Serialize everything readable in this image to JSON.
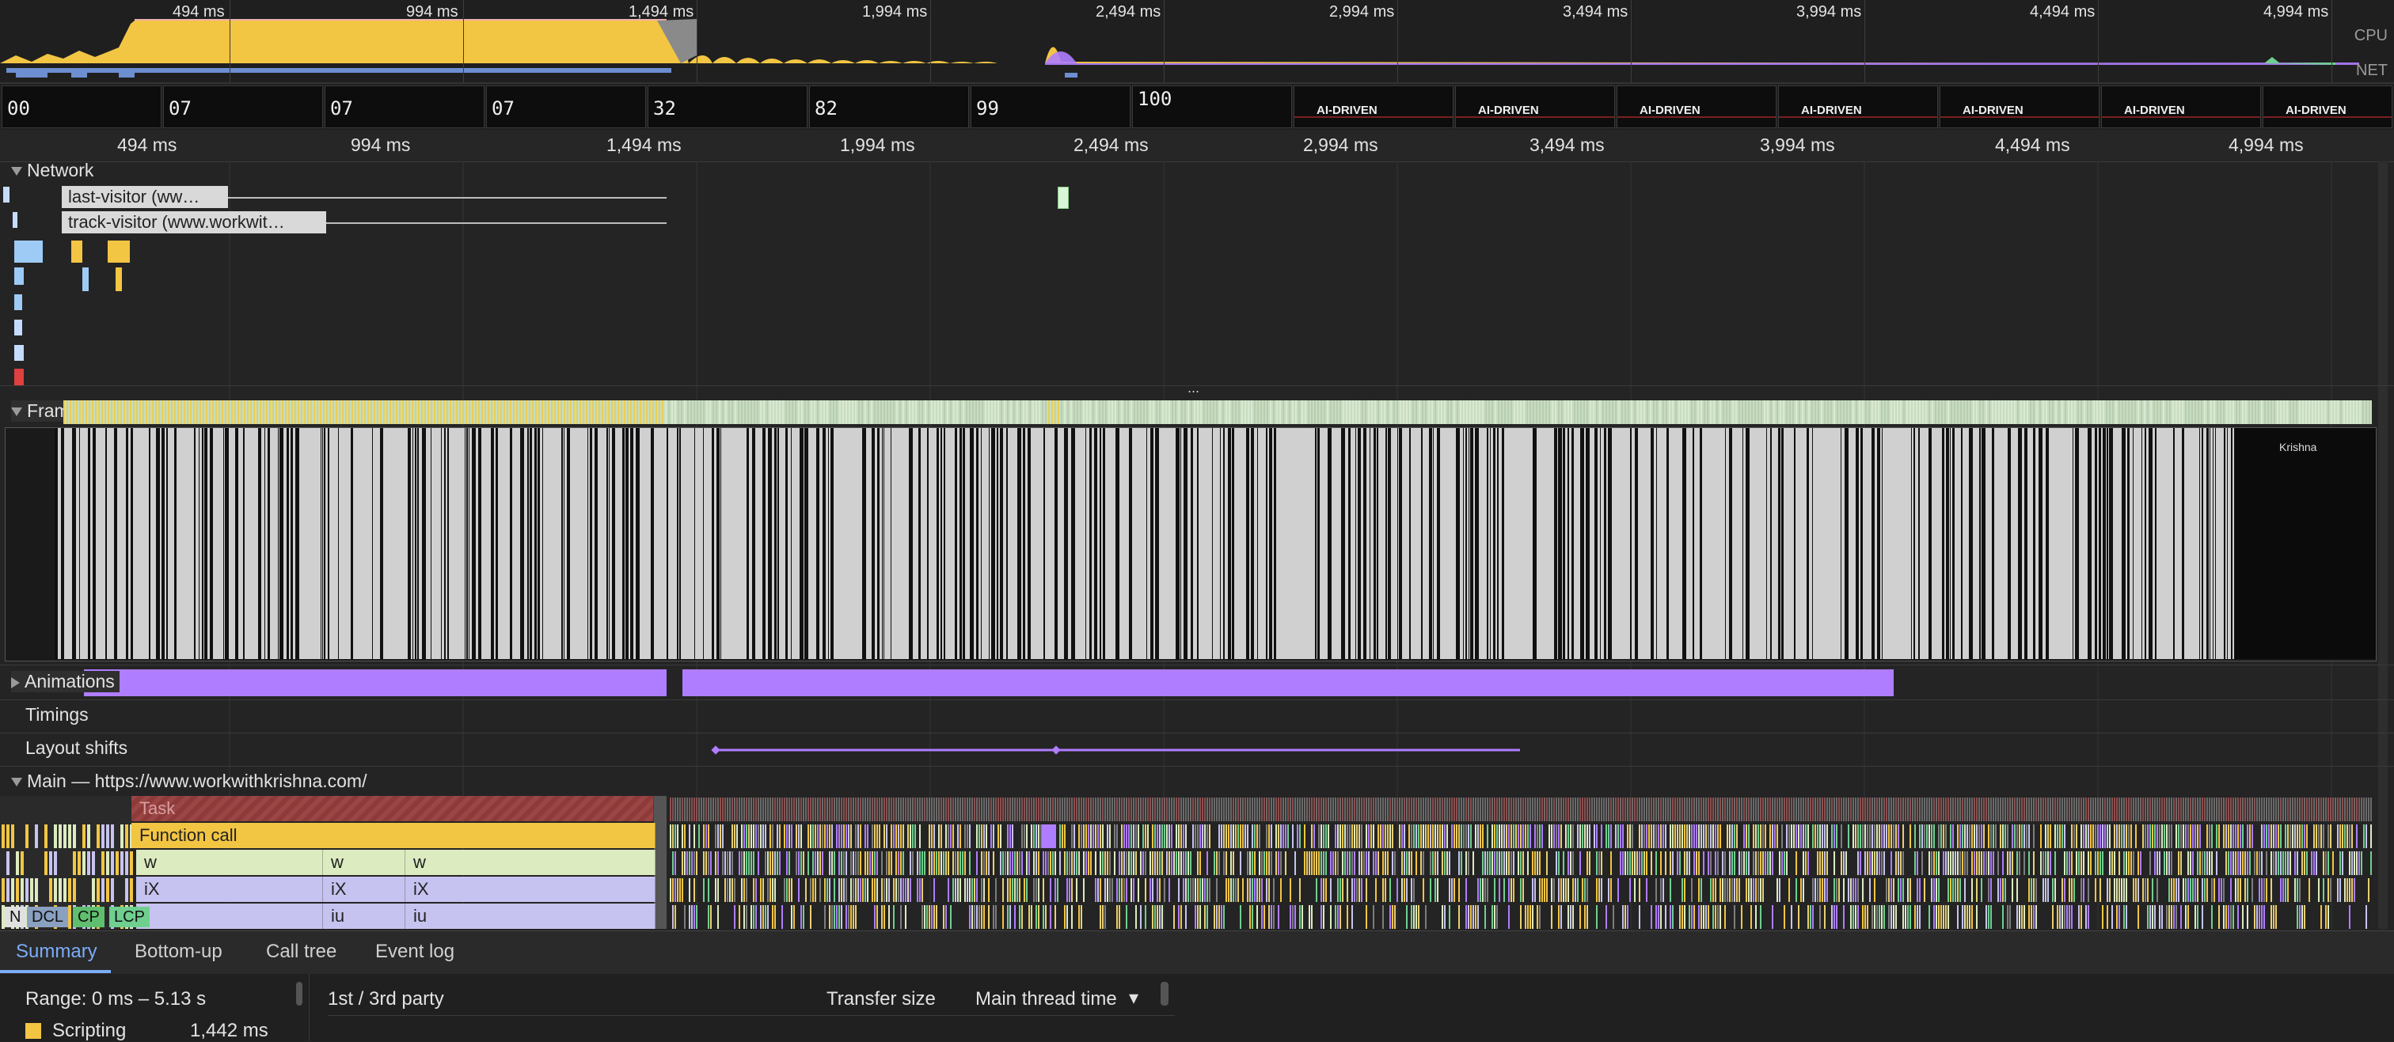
{
  "overview": {
    "ticks": [
      "494 ms",
      "994 ms",
      "1,494 ms",
      "1,994 ms",
      "2,494 ms",
      "2,994 ms",
      "3,494 ms",
      "3,994 ms",
      "4,494 ms",
      "4,994 ms"
    ],
    "cpu_label": "CPU",
    "net_label": "NET"
  },
  "filmstrip": {
    "frames": [
      "00",
      "07",
      "07",
      "07",
      "32",
      "82",
      "99",
      "100",
      "AI-DRIVEN",
      "AI-DRIVEN",
      "AI-DRIVEN",
      "AI-DRIVEN",
      "AI-DRIVEN",
      "AI-DRIVEN",
      "AI-DRIVEN"
    ]
  },
  "ruler": {
    "ticks": [
      "494 ms",
      "994 ms",
      "1,494 ms",
      "1,994 ms",
      "2,494 ms",
      "2,994 ms",
      "3,494 ms",
      "3,994 ms",
      "4,494 ms",
      "4,994 ms"
    ]
  },
  "network": {
    "label": "Network",
    "requests": [
      {
        "label": "last-visitor (ww…"
      },
      {
        "label": "track-visitor (www.workwit…"
      }
    ]
  },
  "more_indicator": "...",
  "frames": {
    "label": "Frames",
    "thumb_caption": "Krishna"
  },
  "animations": {
    "label": "Animations"
  },
  "timings": {
    "label": "Timings"
  },
  "layout_shifts": {
    "label": "Layout shifts"
  },
  "main": {
    "label": "Main — https://www.workwithkrishna.com/",
    "task": "Task",
    "function_call": "Function call",
    "row_w": [
      "w",
      "w",
      "w"
    ],
    "row_ix": [
      "iX",
      "iX",
      "iX"
    ],
    "row_iu": [
      "iu",
      "iu"
    ],
    "markers": [
      "N",
      "DCL",
      "CP",
      "LCP"
    ]
  },
  "tabs": [
    "Summary",
    "Bottom-up",
    "Call tree",
    "Event log"
  ],
  "summary": {
    "range": "Range: 0 ms – 5.13 s",
    "category": "Scripting",
    "category_value": "1,442 ms",
    "party_header": "1st / 3rd party",
    "transfer_header": "Transfer size",
    "thread_header": "Main thread time",
    "sort_arrow": "▾"
  },
  "colors": {
    "scripting": "#f2c543",
    "rendering": "#af7dff",
    "painting": "#6fcf8f",
    "accent": "#7cacf8",
    "task": "#8d3a3a"
  }
}
